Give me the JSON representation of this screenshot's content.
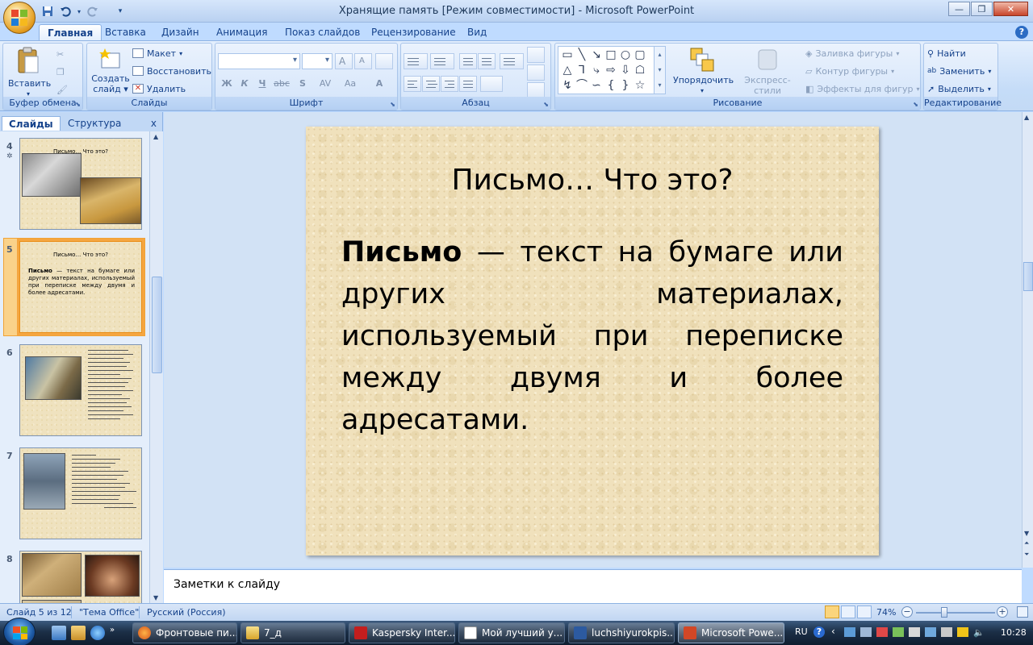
{
  "window": {
    "title": "Хранящие память [Режим совместимости] - Microsoft PowerPoint"
  },
  "ribbon_tabs": [
    "Главная",
    "Вставка",
    "Дизайн",
    "Анимация",
    "Показ слайдов",
    "Рецензирование",
    "Вид"
  ],
  "ribbon": {
    "clipboard": {
      "label": "Буфер обмена",
      "paste": "Вставить"
    },
    "slides": {
      "label": "Слайды",
      "new_slide_1": "Создать",
      "new_slide_2": "слайд",
      "layout": "Макет",
      "reset": "Восстановить",
      "delete": "Удалить"
    },
    "font": {
      "label": "Шрифт",
      "bold": "Ж",
      "italic": "К",
      "underline": "Ч",
      "strike": "abc",
      "shadow": "S",
      "spacing": "AV",
      "case": "Aa",
      "grow": "A",
      "shrink": "A",
      "color": "A"
    },
    "paragraph": {
      "label": "Абзац"
    },
    "drawing": {
      "label": "Рисование",
      "arrange": "Упорядочить",
      "quick_styles": "Экспресс-стили",
      "fill": "Заливка фигуры",
      "outline": "Контур фигуры",
      "effects": "Эффекты для фигур"
    },
    "editing": {
      "label": "Редактирование",
      "find": "Найти",
      "replace": "Заменить",
      "select": "Выделить"
    }
  },
  "left_panel": {
    "tab_slides": "Слайды",
    "tab_outline": "Структура",
    "close": "x",
    "thumbnails": [
      {
        "num": "4",
        "title": "Письмо… Что это?"
      },
      {
        "num": "5",
        "title": "Письмо… Что это?",
        "body_bold": "Письмо",
        "body": " — текст на бумаге или других материалах, используемый при переписке между двумя и более адресатами."
      },
      {
        "num": "6"
      },
      {
        "num": "7"
      },
      {
        "num": "8"
      }
    ]
  },
  "slide": {
    "title": "Письмо… Что это?",
    "body_bold": "Письмо",
    "body_text": " — текст на бумаге или других материалах, используемый при переписке между двумя и более адресатами."
  },
  "notes": {
    "placeholder": "Заметки к слайду"
  },
  "status": {
    "slide_info": "Слайд 5 из 12",
    "theme": "\"Тема Office\"",
    "language": "Русский (Россия)",
    "zoom": "74%",
    "zoom_fraction": 0.74
  },
  "taskbar": {
    "items": [
      "Фронтовые пи...",
      "7_д",
      "Kaspersky Inter...",
      "Мой лучший у...",
      "luchshiyurokpis...",
      "Microsoft Powe..."
    ],
    "lang": "RU",
    "time": "10:28"
  },
  "colors": {
    "ribbon_bg": "#c5dcf8",
    "slide_bg": "#f0e1bc",
    "selected_thumb": "#f5a640",
    "taskbar": "#1c2f47"
  }
}
